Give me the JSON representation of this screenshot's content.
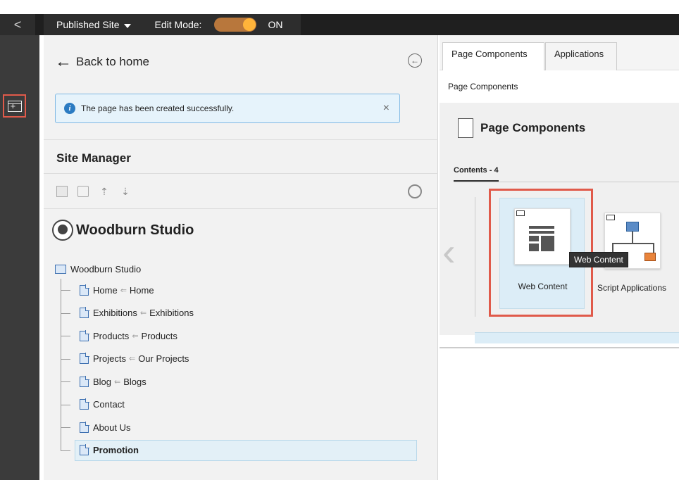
{
  "topbar": {
    "back_glyph": "<",
    "site_label": "Published Site",
    "edit_mode_label": "Edit Mode:",
    "edit_mode_state": "ON",
    "toggle_color": "#b8773c"
  },
  "rail": {
    "add_icon": "add-page-icon"
  },
  "site_panel": {
    "back_label": "Back to home",
    "alert_text": "The page has been created successfully.",
    "alert_close": "×",
    "title": "Site Manager",
    "site_name": "Woodburn Studio",
    "tree": {
      "root": "Woodburn Studio",
      "items": [
        {
          "name": "Home",
          "alias": "Home"
        },
        {
          "name": "Exhibitions",
          "alias": "Exhibitions"
        },
        {
          "name": "Products",
          "alias": "Products"
        },
        {
          "name": "Projects",
          "alias": "Our Projects"
        },
        {
          "name": "Blog",
          "alias": "Blogs"
        },
        {
          "name": "Contact"
        },
        {
          "name": "About Us"
        },
        {
          "name": "Promotion"
        }
      ]
    }
  },
  "components_panel": {
    "tabs": [
      "Page Components",
      "Applications"
    ],
    "subtitle": "Page Components",
    "heading": "Page Components",
    "contents_tab": "Contents - 4",
    "cards": [
      {
        "label": "Web Content",
        "icon": "web-content-icon",
        "selected": true
      },
      {
        "label": "Script Applications",
        "icon": "script-applications-icon",
        "selected": false
      }
    ],
    "tooltip": "Web Content"
  },
  "colors": {
    "highlight": "#e05a4a",
    "selection_bg": "#dcedf7",
    "alert_bg": "#e6f3fb"
  }
}
